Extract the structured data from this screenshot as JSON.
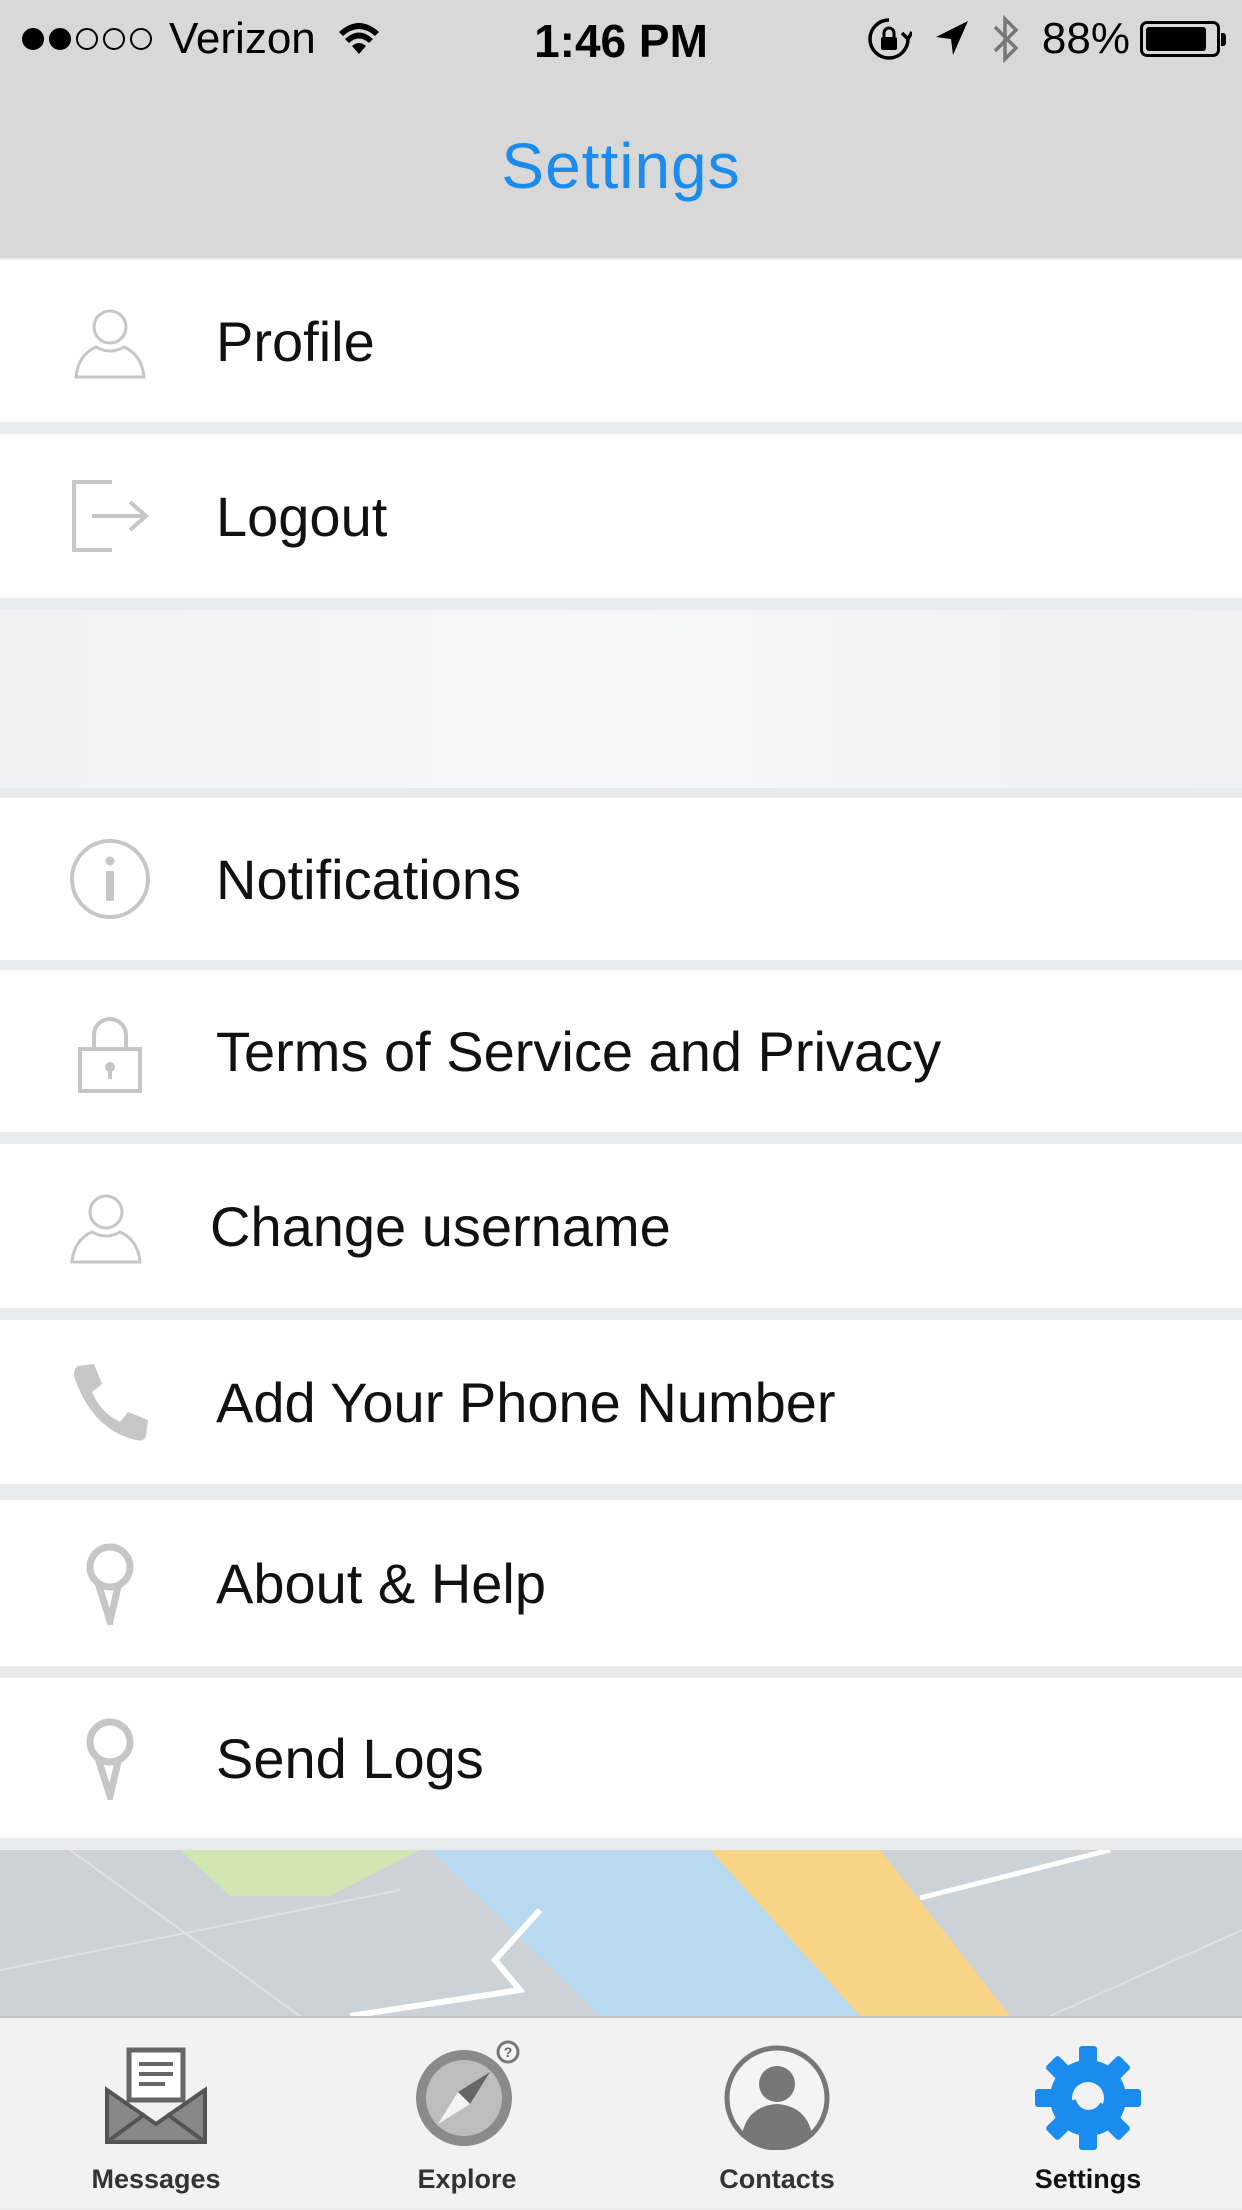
{
  "status_bar": {
    "carrier": "Verizon",
    "signal_strength": 2,
    "signal_total": 5,
    "time": "1:46 PM",
    "battery": "88%",
    "battery_level": 0.88
  },
  "header": {
    "title": "Settings",
    "title_color": "#1a8cf0"
  },
  "menu": {
    "profile": "Profile",
    "logout": "Logout",
    "notifications": "Notifications",
    "terms": "Terms of Service and Privacy",
    "change_username": "Change username",
    "add_phone": "Add Your Phone Number",
    "about_help": "About & Help",
    "send_logs": "Send Logs"
  },
  "icons": {
    "profile": "person-outline-icon",
    "logout": "logout-icon",
    "notifications": "info-icon",
    "terms": "lock-icon",
    "change_username": "person-outline-icon",
    "add_phone": "phone-icon",
    "about_help": "pin-icon",
    "send_logs": "pin-icon"
  },
  "tab_bar": {
    "messages": "Messages",
    "explore": "Explore",
    "contacts": "Contacts",
    "settings": "Settings",
    "active": "settings",
    "active_color": "#1a8cf0"
  }
}
